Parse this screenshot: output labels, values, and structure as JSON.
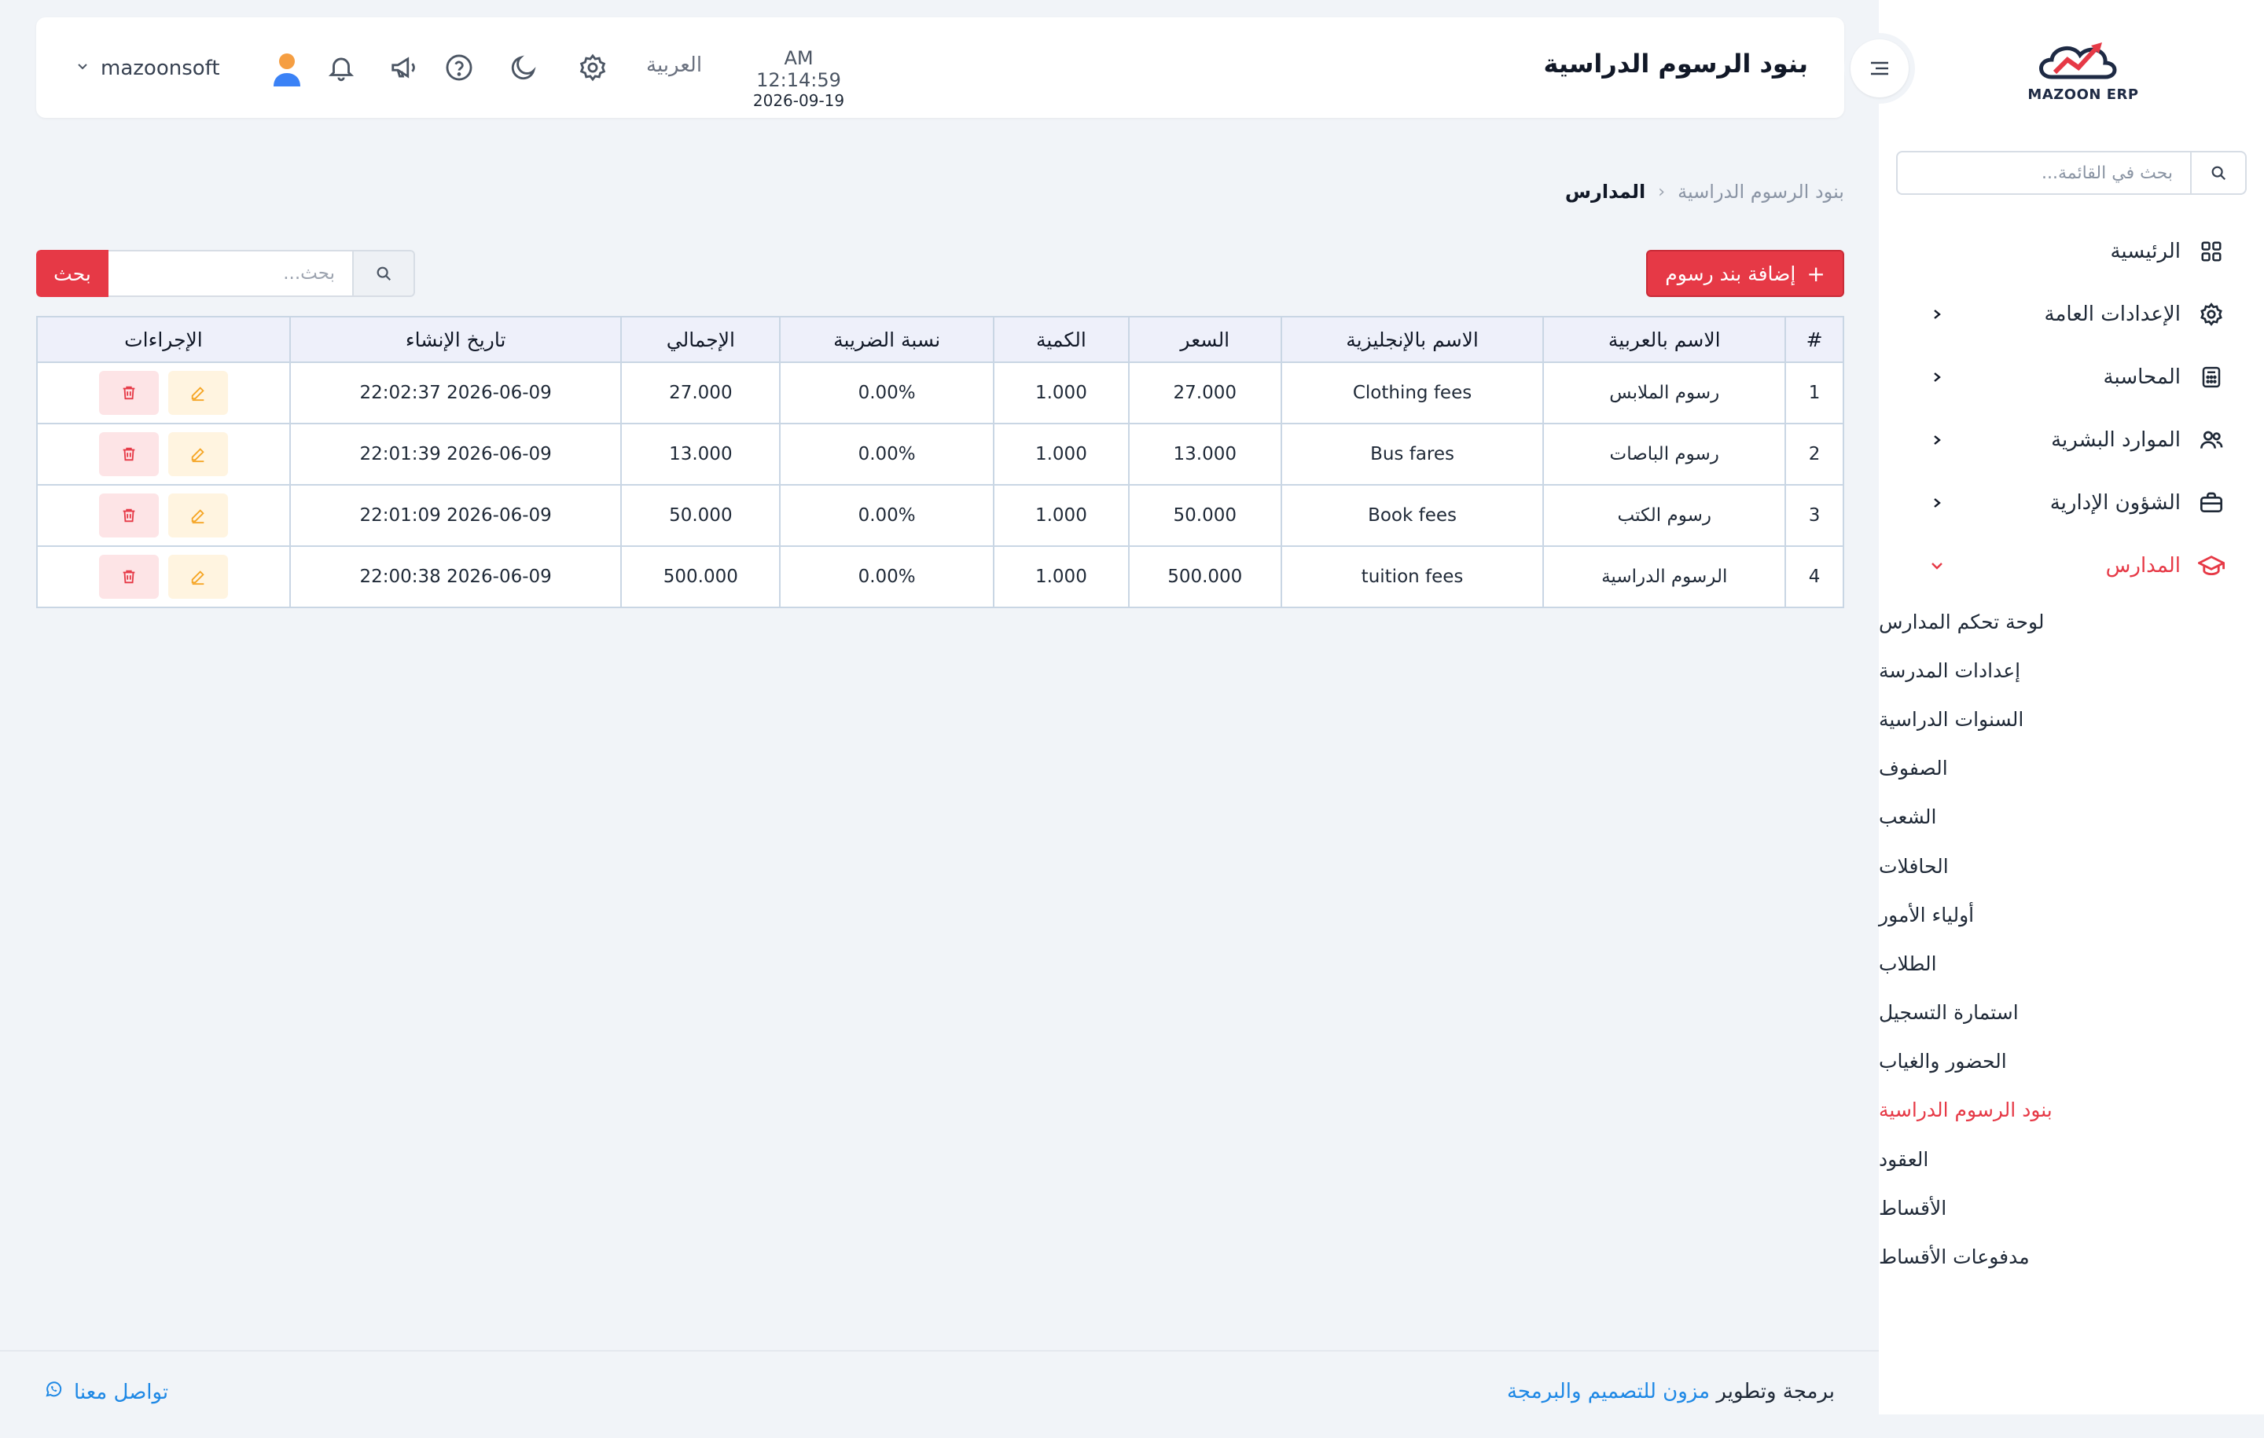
{
  "sidebar": {
    "logo_text": "MAZOON ERP",
    "search_placeholder": "بحث في القائمة...",
    "items": [
      {
        "label": "الرئيسية",
        "icon": "grid-icon"
      },
      {
        "label": "الإعدادات العامة",
        "icon": "gear-icon"
      },
      {
        "label": "المحاسبة",
        "icon": "calculator-icon"
      },
      {
        "label": "الموارد البشرية",
        "icon": "users-icon"
      },
      {
        "label": "الشؤون الإدارية",
        "icon": "briefcase-icon"
      },
      {
        "label": "المدارس",
        "icon": "graduation-cap-icon"
      }
    ],
    "submenu": [
      "لوحة تحكم المدارس",
      "إعدادات المدرسة",
      "السنوات الدراسية",
      "الصفوف",
      "الشعب",
      "الحافلات",
      "أولياء الأمور",
      "الطلاب",
      "استمارة التسجيل",
      "الحضور والغياب",
      "بنود الرسوم الدراسية",
      "العقود",
      "الأقساط",
      "مدفوعات الأقساط"
    ]
  },
  "header": {
    "title": "بنود الرسوم الدراسية",
    "time": "AM 12:14:59",
    "date": "2026-09-19",
    "language": "العربية",
    "username": "mazoonsoft"
  },
  "breadcrumb": {
    "root": "المدارس",
    "separator": "‹",
    "current": "بنود الرسوم الدراسية"
  },
  "toolbar": {
    "add_label": "إضافة بند رسوم",
    "add_symbol": "+",
    "search_placeholder": "بحث...",
    "search_button": "بحث"
  },
  "table": {
    "headers": [
      "#",
      "الاسم بالعربية",
      "الاسم بالإنجليزية",
      "السعر",
      "الكمية",
      "نسبة الضريبة",
      "الإجمالي",
      "تاريخ الإنشاء",
      "الإجراءات"
    ],
    "rows": [
      [
        "1",
        "رسوم الملابس",
        "Clothing fees",
        "27.000",
        "1.000",
        "0.00%",
        "27.000",
        "2026-06-09 22:02:37"
      ],
      [
        "2",
        "رسوم الباصات",
        "Bus fares",
        "13.000",
        "1.000",
        "0.00%",
        "13.000",
        "2026-06-09 22:01:39"
      ],
      [
        "3",
        "رسوم الكتب",
        "Book fees",
        "50.000",
        "1.000",
        "0.00%",
        "50.000",
        "2026-06-09 22:01:09"
      ],
      [
        "4",
        "الرسوم الدراسية",
        "tuition fees",
        "500.000",
        "1.000",
        "0.00%",
        "500.000",
        "2026-06-09 22:00:38"
      ]
    ]
  },
  "footer": {
    "prefix": "برمجة وتطوير",
    "brand": "مزون للتصميم والبرمجة",
    "contact": "تواصل معنا"
  },
  "colors": {
    "accent": "#e63946",
    "link": "#1e88e5",
    "background": "#f1f4f8"
  }
}
